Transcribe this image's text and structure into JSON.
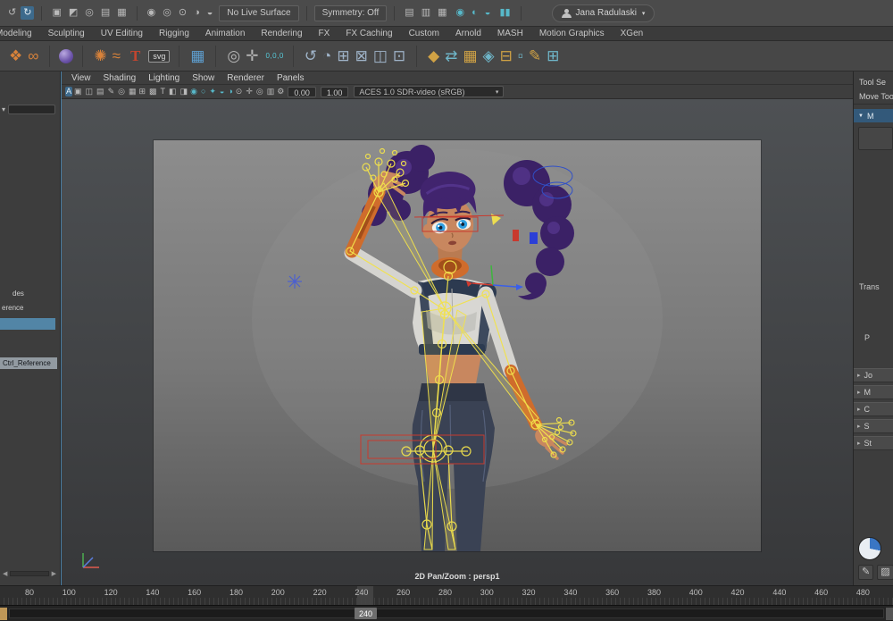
{
  "status_line": {
    "history_icons": [
      "↺",
      "↻"
    ],
    "selection_icons": [
      "▣",
      "◩",
      "◎",
      "▤",
      "▦"
    ],
    "snap_icons": [
      "◉",
      "◎",
      "⊙",
      "◑",
      "◒"
    ],
    "live_surface_label": "No Live Surface",
    "symmetry_label": "Symmetry: Off",
    "render_icons": [
      "▤",
      "▥",
      "▦"
    ],
    "ipr_icons": [
      "◉",
      "◐",
      "◒"
    ],
    "pause_icon": "▮▮",
    "user_name": "Jana Radulaski",
    "caret": "▾"
  },
  "shelf_tabs": [
    "Modeling",
    "Sculpting",
    "UV Editing",
    "Rigging",
    "Animation",
    "Rendering",
    "FX",
    "FX Caching",
    "Custom",
    "Arnold",
    "MASH",
    "Motion Graphics",
    "XGen"
  ],
  "shelf": {
    "curve_icons": [
      "❖",
      "∞"
    ],
    "deform_icons": [
      "✺",
      "≈"
    ],
    "type_label": "T",
    "svg_label": "svg",
    "table_icon": "▦",
    "measure_icons": [
      "◎",
      "✛"
    ],
    "coords_label": "0,0,0",
    "constraint_icons": [
      "↺",
      "◔",
      "⊞",
      "⊠",
      "◫",
      "⊡"
    ],
    "rigging_icons": [
      "◆",
      "⇄",
      "▦",
      "◈",
      "⊟",
      "▫",
      "✎",
      "⊞"
    ]
  },
  "viewport": {
    "menus": [
      "View",
      "Shading",
      "Lighting",
      "Show",
      "Renderer",
      "Panels"
    ],
    "active_icon": "A",
    "display_icons": [
      "▣",
      "◫",
      "▤",
      "✎",
      "◎",
      "▦"
    ],
    "camera_icons": [
      "⊞",
      "▩",
      "T",
      "◧",
      "◨"
    ],
    "lighting_icons": [
      "◉",
      "○",
      "✦",
      "◒",
      "◑"
    ],
    "shading_icons": [
      "⊙",
      "✛",
      "◎",
      "▥"
    ],
    "gear_icon": "⚙",
    "exposure_value": "0.00",
    "gamma_value": "1.00",
    "colorspace_value": "ACES 1.0 SDR-video (sRGB)",
    "caret": "▾",
    "pan_zoom_label": "2D Pan/Zoom : persp1"
  },
  "outliner": {
    "caret": "▾",
    "item_partial_1": "des",
    "item_partial_2": "erence",
    "reference_item": "Ctrl_Reference",
    "scroll_left": "◀",
    "scroll_right": "▶"
  },
  "tool_settings": {
    "title": "Tool Se",
    "tool_name": "Move Too",
    "header_label": "M",
    "header_caret": "▼",
    "transform_label": "Trans",
    "presets_label": "P",
    "section_caret": "▸",
    "sections": [
      "Jo",
      "M",
      "C",
      "S",
      "St"
    ],
    "pencil_icon": "✎",
    "eraser_icon": "▨"
  },
  "timeline": {
    "ticks": [
      "80",
      "100",
      "120",
      "140",
      "160",
      "180",
      "200",
      "220",
      "240",
      "260",
      "280",
      "300",
      "320",
      "340",
      "360",
      "380",
      "400",
      "420",
      "440",
      "460",
      "480"
    ],
    "current_frame": "240"
  }
}
